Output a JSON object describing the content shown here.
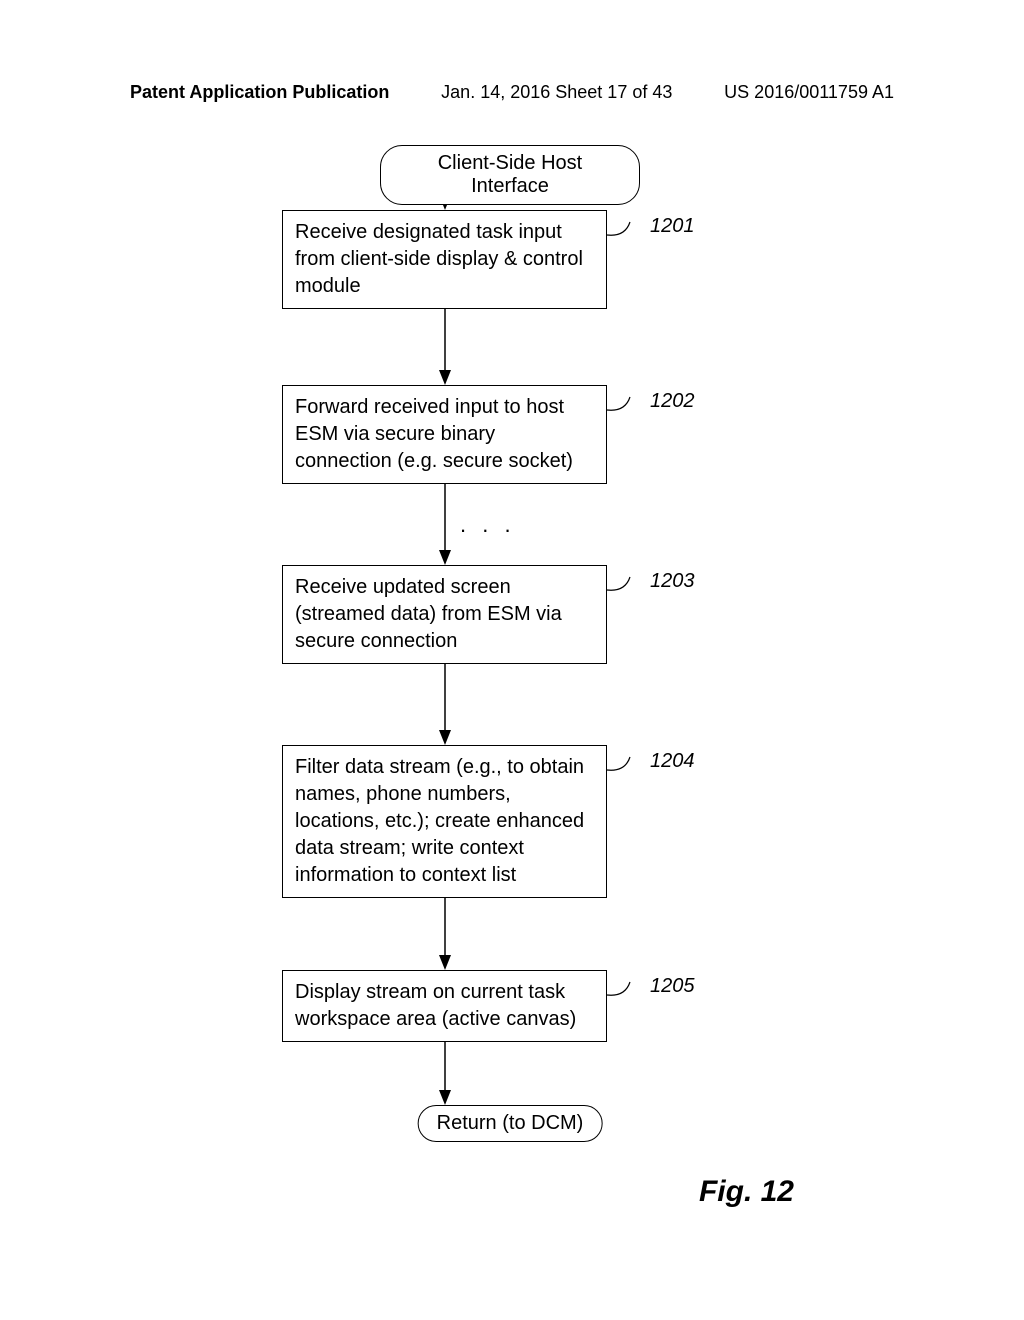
{
  "header": {
    "left": "Patent Application Publication",
    "center": "Jan. 14, 2016   Sheet 17 of 43",
    "right": "US 2016/0011759 A1"
  },
  "flowchart": {
    "start": "Client-Side Host Interface",
    "steps": [
      {
        "ref": "1201",
        "text": "Receive designated task input from client-side display & control module"
      },
      {
        "ref": "1202",
        "text": "Forward received input to host ESM via secure binary connection (e.g. secure socket)"
      },
      {
        "ref": "1203",
        "text": "Receive updated screen (streamed data) from ESM via secure connection"
      },
      {
        "ref": "1204",
        "text": "Filter data stream (e.g., to obtain names, phone numbers, locations, etc.); create enhanced data stream; write context information to context list"
      },
      {
        "ref": "1205",
        "text": "Display stream on current task workspace area (active canvas)"
      }
    ],
    "end": "Return (to DCM)",
    "dots": ". . ."
  },
  "figure_label": "Fig. 12"
}
